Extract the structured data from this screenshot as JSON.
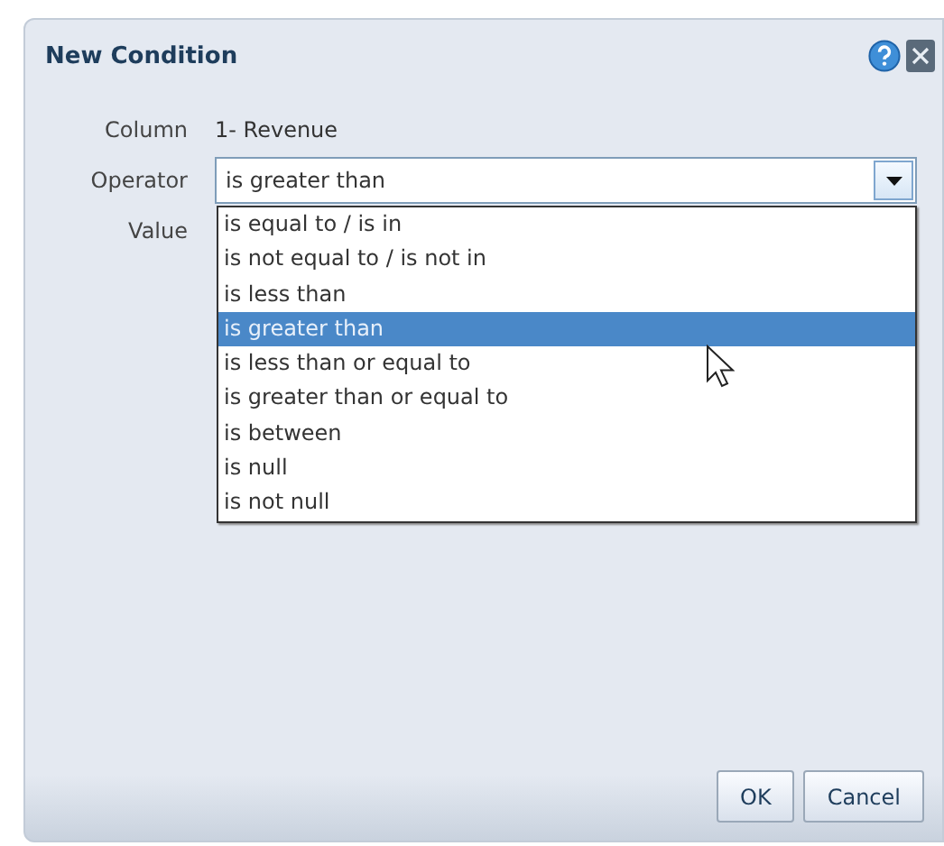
{
  "dialog": {
    "title": "New Condition"
  },
  "fields": [
    {
      "kind": "text",
      "label": "Column",
      "value": "1- Revenue"
    },
    {
      "kind": "select",
      "label": "Operator",
      "value": "is greater than",
      "expanded": true,
      "options": [
        {
          "label": "is equal to / is in",
          "selected": false
        },
        {
          "label": "is not equal to / is not in",
          "selected": false
        },
        {
          "label": "is less than",
          "selected": false
        },
        {
          "label": "is greater than",
          "selected": true
        },
        {
          "label": "is less than or equal to",
          "selected": false
        },
        {
          "label": "is greater than or equal to",
          "selected": false
        },
        {
          "label": "is between",
          "selected": false
        },
        {
          "label": "is null",
          "selected": false
        },
        {
          "label": "is not null",
          "selected": false
        }
      ]
    },
    {
      "kind": "label",
      "label": "Value"
    }
  ],
  "buttons": [
    "OK",
    "Cancel"
  ]
}
